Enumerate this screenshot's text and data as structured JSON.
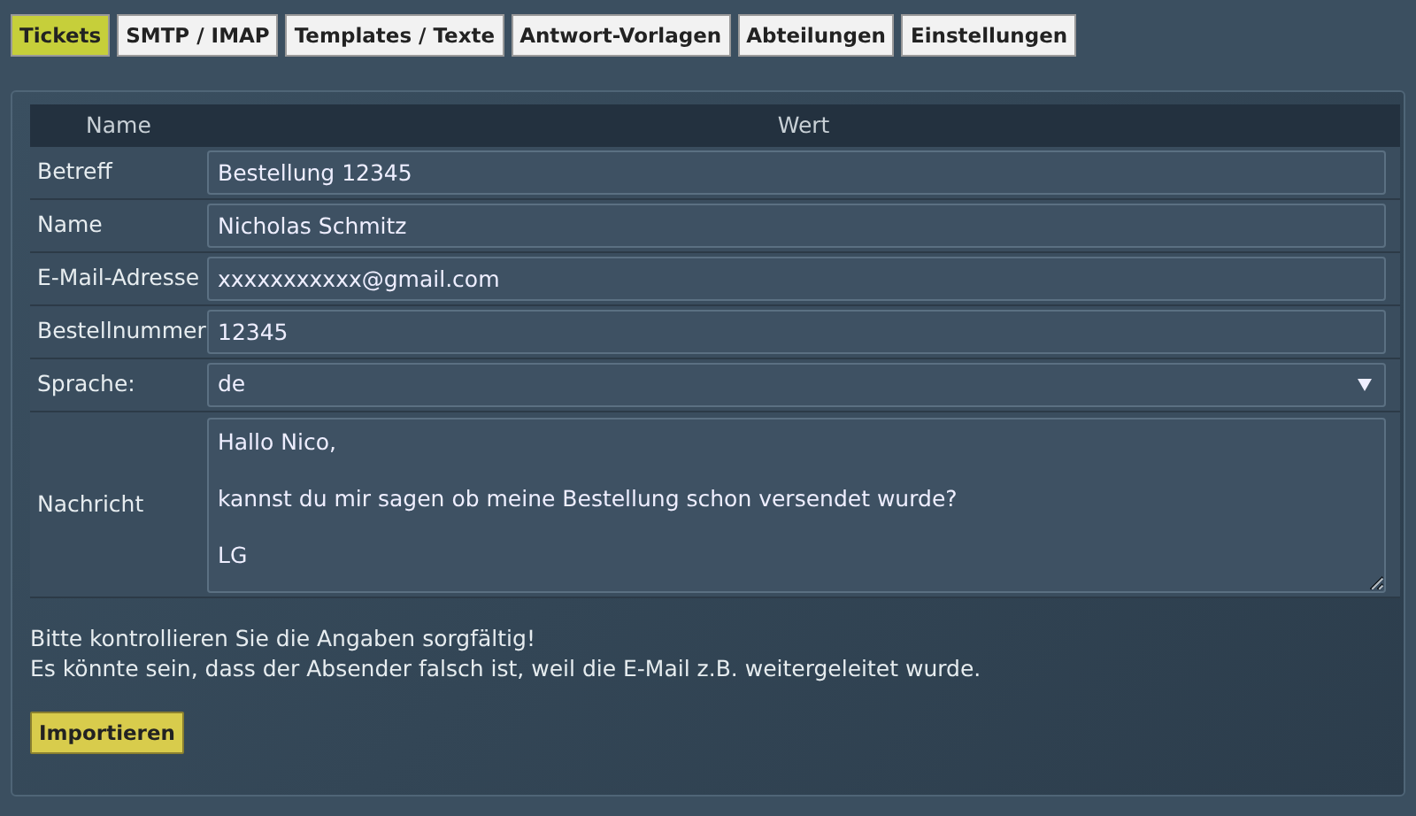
{
  "tabs": [
    {
      "label": "Tickets",
      "selected": true
    },
    {
      "label": "SMTP / IMAP",
      "selected": false
    },
    {
      "label": "Templates / Texte",
      "selected": false
    },
    {
      "label": "Antwort-Vorlagen",
      "selected": false
    },
    {
      "label": "Abteilungen",
      "selected": false
    },
    {
      "label": "Einstellungen",
      "selected": false
    }
  ],
  "table": {
    "columns": [
      "Name",
      "Wert"
    ],
    "rows": [
      {
        "kind": "text",
        "name": "Betreff",
        "value": "Bestellung 12345"
      },
      {
        "kind": "text",
        "name": "Name",
        "value": "Nicholas Schmitz"
      },
      {
        "kind": "text",
        "name": "E-Mail-Adresse",
        "value": "xxxxxxxxxxx@gmail.com"
      },
      {
        "kind": "text",
        "name": "Bestellnummer",
        "value": "12345"
      },
      {
        "kind": "select",
        "name": "Sprache:",
        "value": "de"
      },
      {
        "kind": "textarea",
        "name": "Nachricht",
        "value": "Hallo Nico,\n\nkannst du mir sagen ob meine Bestellung schon versendet wurde?\n\nLG"
      }
    ]
  },
  "notice": [
    "Bitte kontrollieren Sie die Angaben sorgfältig!",
    "Es könnte sein, dass der Absender falsch ist, weil die E-Mail z.B. weitergeleitet wurde."
  ],
  "buttons": [
    "Importieren"
  ]
}
